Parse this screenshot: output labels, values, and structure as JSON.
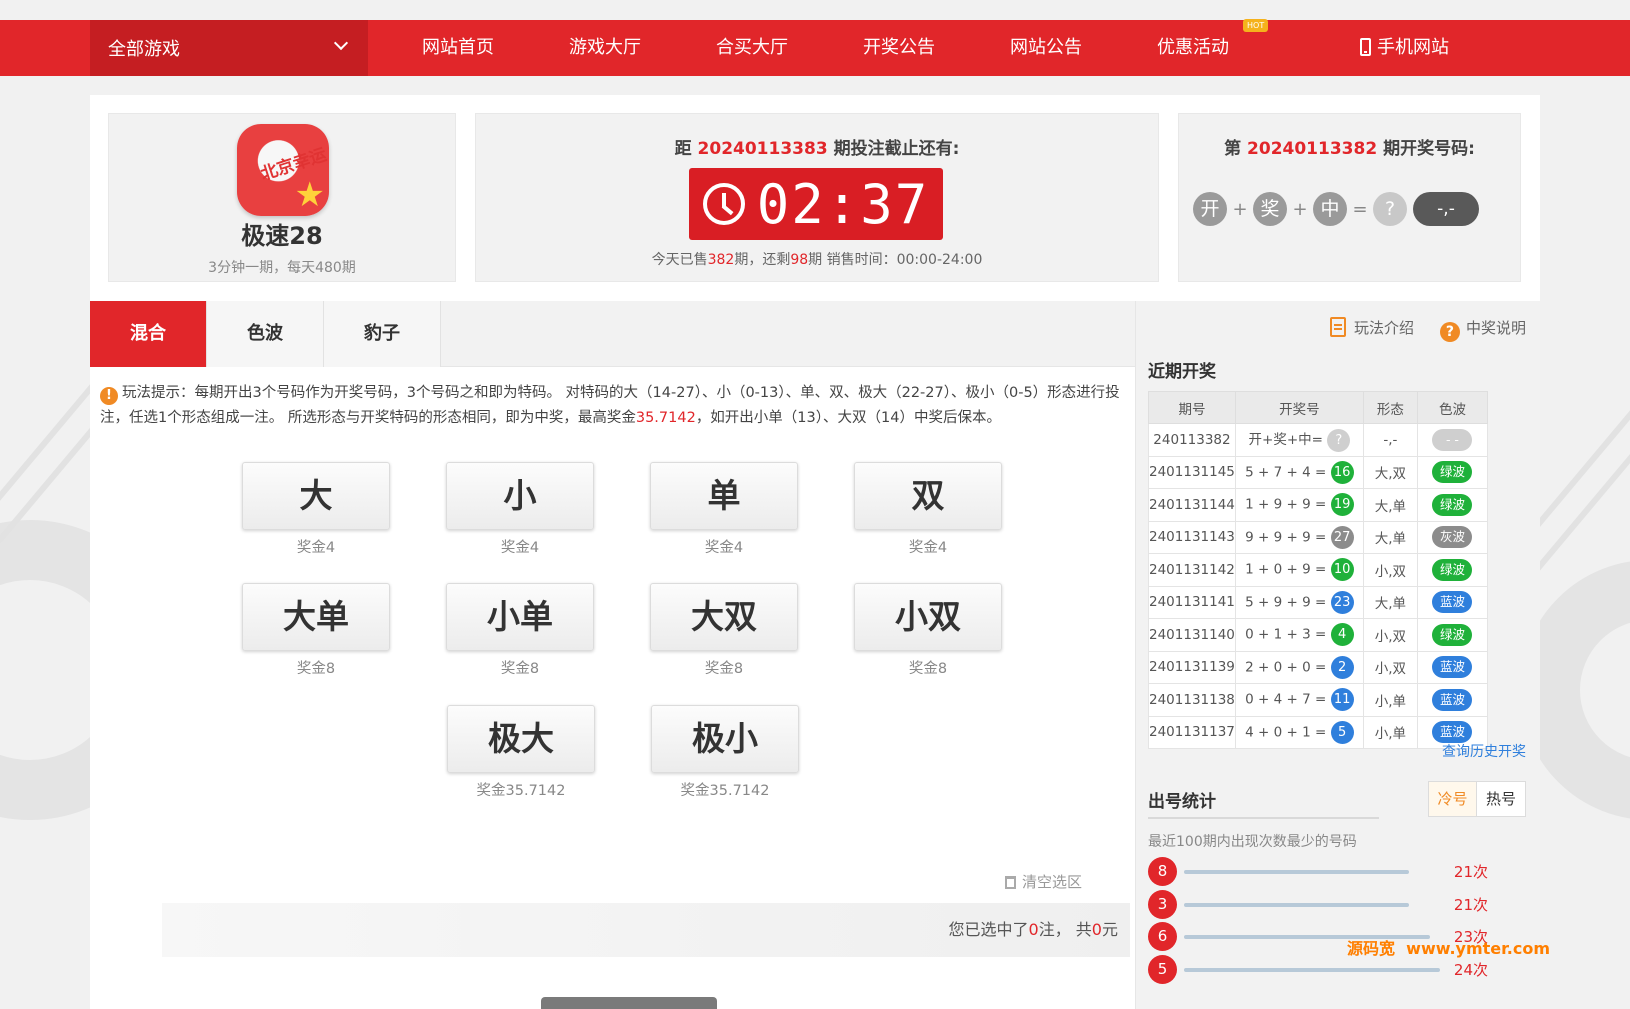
{
  "nav": {
    "all_games": "全部游戏",
    "items": [
      "网站首页",
      "游戏大厅",
      "合买大厅",
      "开奖公告",
      "网站公告",
      "优惠活动"
    ],
    "hot_badge": "HOT",
    "mobile": "手机网站"
  },
  "game": {
    "logo_text": "北京幸运",
    "name": "极速28",
    "desc": "3分钟一期，每天480期"
  },
  "countdown": {
    "prefix": "距",
    "issue": "20240113383",
    "suffix": "期投注截止还有:",
    "time": "02:37",
    "sold_prefix": "今天已售",
    "sold": "382",
    "sold_mid": "期，还剩",
    "remain": "98",
    "sold_suffix": "期 销售时间：00:00-24:00"
  },
  "last_draw": {
    "prefix": "第",
    "issue": "20240113382",
    "suffix": "期开奖号码:",
    "balls": [
      "开",
      "奖",
      "中"
    ],
    "plus": "+",
    "equals": "=",
    "unknown": "?",
    "result": "-,-"
  },
  "tabs": [
    "混合",
    "色波",
    "豹子"
  ],
  "tip": {
    "icon": "!",
    "text1": "玩法提示：每期开出3个号码作为开奖号码，3个号码之和即为特码。 对特码的大（14-27）、小（0-13）、单、双、极大（22-27）、极小（0-5）形态进行投注，任选1个形态组成一注。 所选形态与开奖特码的形态相同，即为中奖，最高奖金",
    "highlight": "35.7142",
    "text2": "，如开出小单（13）、大双（14）中奖后保本。"
  },
  "bets": [
    {
      "label": "大",
      "prize": "奖金4"
    },
    {
      "label": "小",
      "prize": "奖金4"
    },
    {
      "label": "单",
      "prize": "奖金4"
    },
    {
      "label": "双",
      "prize": "奖金4"
    },
    {
      "label": "大单",
      "prize": "奖金8"
    },
    {
      "label": "小单",
      "prize": "奖金8"
    },
    {
      "label": "大双",
      "prize": "奖金8"
    },
    {
      "label": "小双",
      "prize": "奖金8"
    },
    {
      "label": "极大",
      "prize": "奖金35.7142"
    },
    {
      "label": "极小",
      "prize": "奖金35.7142"
    }
  ],
  "clear_label": "清空选区",
  "summary": {
    "prefix": "您已选中了",
    "count": "0",
    "mid": "注， 共",
    "amount": "0",
    "suffix": "元"
  },
  "right": {
    "rules_link": "玩法介绍",
    "prize_link": "中奖说明",
    "recent_title": "近期开奖",
    "columns": [
      "期号",
      "开奖号",
      "形态",
      "色波"
    ],
    "first_row": {
      "issue": "240113382",
      "draw": "开+奖+中=",
      "ball": "?",
      "form": "-,-",
      "wave": "- -"
    },
    "rows": [
      {
        "issue": "2401131145",
        "draw": "5 + 7 + 4 =",
        "sum": "16",
        "color": "green",
        "form": "大,双",
        "wave": "绿波"
      },
      {
        "issue": "2401131144",
        "draw": "1 + 9 + 9 =",
        "sum": "19",
        "color": "green",
        "form": "大,单",
        "wave": "绿波"
      },
      {
        "issue": "2401131143",
        "draw": "9 + 9 + 9 =",
        "sum": "27",
        "color": "gray",
        "form": "大,单",
        "wave": "灰波"
      },
      {
        "issue": "2401131142",
        "draw": "1 + 0 + 9 =",
        "sum": "10",
        "color": "green",
        "form": "小,双",
        "wave": "绿波"
      },
      {
        "issue": "2401131141",
        "draw": "5 + 9 + 9 =",
        "sum": "23",
        "color": "blue",
        "form": "大,单",
        "wave": "蓝波"
      },
      {
        "issue": "2401131140",
        "draw": "0 + 1 + 3 =",
        "sum": "4",
        "color": "green",
        "form": "小,双",
        "wave": "绿波"
      },
      {
        "issue": "2401131139",
        "draw": "2 + 0 + 0 =",
        "sum": "2",
        "color": "blue",
        "form": "小,双",
        "wave": "蓝波"
      },
      {
        "issue": "2401131138",
        "draw": "0 + 4 + 7 =",
        "sum": "11",
        "color": "blue",
        "form": "小,单",
        "wave": "蓝波"
      },
      {
        "issue": "2401131137",
        "draw": "4 + 0 + 1 =",
        "sum": "5",
        "color": "blue",
        "form": "小,单",
        "wave": "蓝波"
      }
    ],
    "more_link": "查询历史开奖",
    "stats_title": "出号统计",
    "stat_tabs": [
      "冷号",
      "热号"
    ],
    "stats_desc": "最近100期内出现次数最少的号码",
    "stats": [
      {
        "num": "8",
        "count": "21次",
        "level": 0.88
      },
      {
        "num": "3",
        "count": "21次",
        "level": 0.88
      },
      {
        "num": "6",
        "count": "23次",
        "level": 0.96
      },
      {
        "num": "5",
        "count": "24次",
        "level": 1.0
      }
    ]
  },
  "colors": {
    "brand_red": "#e1262a",
    "green": "#1fb13a",
    "blue": "#2f7fdc",
    "gray": "#8c8c8c"
  },
  "watermark": {
    "a": "源码宽",
    "b": "www.ymter.com"
  }
}
